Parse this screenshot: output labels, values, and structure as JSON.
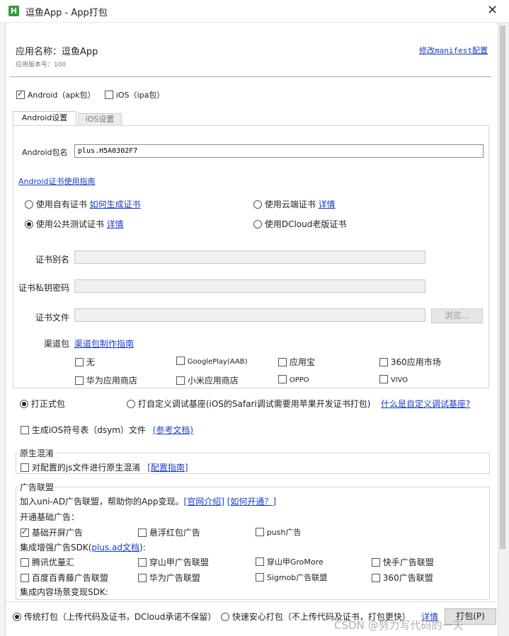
{
  "window": {
    "title": "逗鱼App - App打包",
    "icon_letter": "H"
  },
  "header": {
    "app_name_label": "应用名称：",
    "app_name": "逗鱼App",
    "version_label": "应用版本号：100",
    "manifest_link": "修改manifest配置"
  },
  "platforms": [
    {
      "label": "Android（apk包）",
      "checked": true
    },
    {
      "label": "iOS（ipa包）",
      "checked": false
    }
  ],
  "tabs": [
    {
      "label": "Android设置",
      "active": true
    },
    {
      "label": "iOS设置",
      "active": false
    }
  ],
  "android": {
    "package_label": "Android包名",
    "package_value": "plus.H5A0302F7",
    "cert_guide_link": "Android证书使用指南",
    "cert_options": [
      {
        "label": "使用自有证书",
        "link": "如何生成证书",
        "selected": false
      },
      {
        "label": "使用云端证书",
        "link": "详情",
        "selected": false
      },
      {
        "label": "使用公共测试证书",
        "link": "详情",
        "selected": true
      },
      {
        "label": "使用DCloud老版证书",
        "link": "",
        "selected": false
      }
    ],
    "alias_label": "证书别名",
    "password_label": "证书私钥密码",
    "file_label": "证书文件",
    "browse_label": "浏览...",
    "channel_label": "渠道包",
    "channel_link": "渠道包制作指南",
    "channels": [
      {
        "label": "无",
        "checked": false
      },
      {
        "label": "GooglePlay(AAB)",
        "checked": false
      },
      {
        "label": "应用宝",
        "checked": false
      },
      {
        "label": "360应用市场",
        "checked": false
      },
      {
        "label": "华为应用商店",
        "checked": false
      },
      {
        "label": "小米应用商店",
        "checked": false
      },
      {
        "label": "OPPO",
        "checked": false
      },
      {
        "label": "VIVO",
        "checked": false
      }
    ]
  },
  "build_type": {
    "formal_label": "打正式包",
    "formal_selected": true,
    "custom_label": "打自定义调试基座(iOS的Safari调试需要用苹果开发证书打包)",
    "custom_selected": false,
    "custom_link": "什么是自定义调试基座?"
  },
  "dsym": {
    "label": "生成iOS符号表（dsym）文件",
    "link": "(参考文档)",
    "checked": false
  },
  "obfuscation": {
    "title": "原生混淆",
    "label": "对配置的js文件进行原生混淆",
    "link": "[配置指南]",
    "checked": false
  },
  "ads": {
    "title": "广告联盟",
    "intro": "加入uni-AD广告联盟，帮助你的App变现。",
    "intro_link1": "[官网介绍]",
    "intro_link2": "[如何开通？]",
    "basic_title": "开通基础广告：",
    "basic": [
      {
        "label": "基础开屏广告",
        "checked": true
      },
      {
        "label": "悬浮红包广告",
        "checked": false
      },
      {
        "label": "push广告",
        "checked": false
      }
    ],
    "sdk_title_prefix": "集成增强广告SDK(",
    "sdk_title_link": "plus.ad文档",
    "sdk_title_suffix": "):",
    "sdks": [
      {
        "label": "腾讯优量汇",
        "checked": false
      },
      {
        "label": "穿山甲广告联盟",
        "checked": false
      },
      {
        "label": "穿山甲GroMore",
        "checked": false
      },
      {
        "label": "快手广告联盟",
        "checked": false
      },
      {
        "label": "百度百青藤广告联盟",
        "checked": false
      },
      {
        "label": "华为广告联盟",
        "checked": false
      },
      {
        "label": "Sigmob广告联盟",
        "checked": false
      },
      {
        "label": "360广告联盟",
        "checked": false
      }
    ],
    "content_title": "集成内容场景变现SDK:"
  },
  "footer": {
    "traditional_label": "传统打包（上传代码及证书，DCloud承诺不保留）",
    "traditional_selected": true,
    "safe_label": "快速安心打包（不上传代码及证书，打包更快）",
    "safe_selected": false,
    "details_link": "详情",
    "pack_button": "打包(P)"
  },
  "watermark": "CSDN @努力写代码的一天"
}
